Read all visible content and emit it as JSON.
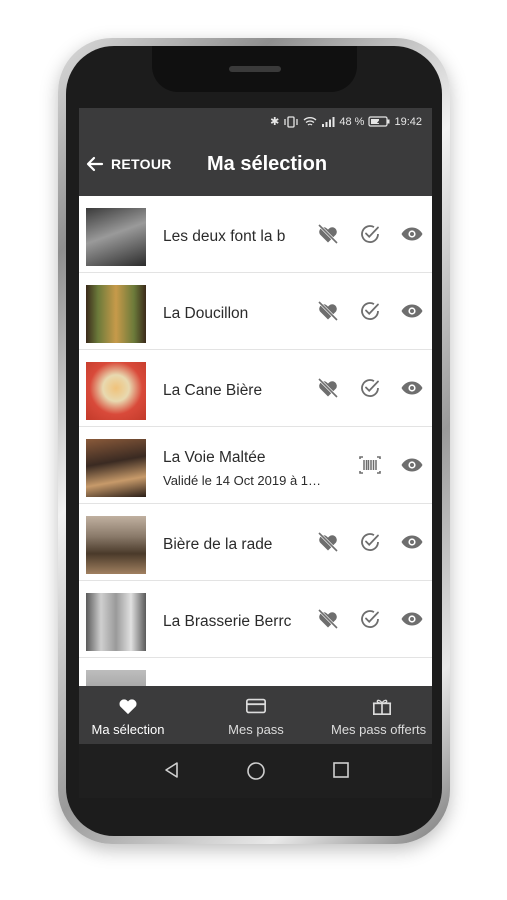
{
  "status": {
    "bluetooth": "✱",
    "signal": "48 %",
    "time": "19:42"
  },
  "appbar": {
    "back_label": "RETOUR",
    "title": "Ma sélection"
  },
  "places": [
    {
      "name": "Les deux font la b",
      "subtitle": "",
      "validated": false,
      "thumb_colors": [
        "#4a4a4a",
        "#8a8a8a",
        "#2c2c2c"
      ]
    },
    {
      "name": "La Doucillon",
      "subtitle": "",
      "validated": false,
      "thumb_colors": [
        "#6b7a3a",
        "#c79a4a",
        "#3b2a1a"
      ]
    },
    {
      "name": "La Cane Bière",
      "subtitle": "",
      "validated": false,
      "thumb_colors": [
        "#d94a3a",
        "#f0c27a",
        "#e8d9b0"
      ]
    },
    {
      "name": "La Voie Maltée",
      "subtitle": "Validé le 14 Oct 2019 à 1…",
      "validated": true,
      "thumb_colors": [
        "#3a2a22",
        "#8a5a3a",
        "#c79a6a"
      ]
    },
    {
      "name": "Bière de la rade",
      "subtitle": "",
      "validated": false,
      "thumb_colors": [
        "#8a7a6a",
        "#4a3a2a",
        "#c0b0a0"
      ]
    },
    {
      "name": "La Brasserie Berrc",
      "subtitle": "",
      "validated": false,
      "thumb_colors": [
        "#9a9a9a",
        "#5a5a5a",
        "#cfcfcf"
      ]
    }
  ],
  "icons": {
    "unfavorite": "heart-broken-icon",
    "validate": "check-circle-icon",
    "view": "eye-icon",
    "barcode": "barcode-icon"
  },
  "bottom_nav": [
    {
      "label": "Ma sélection",
      "icon": "heart-icon",
      "active": true
    },
    {
      "label": "Mes pass",
      "icon": "card-icon",
      "active": false
    },
    {
      "label": "Mes pass offerts",
      "icon": "gift-icon",
      "active": false
    }
  ],
  "colors": {
    "bar": "#3b3b3c",
    "icon": "#6e6e6e",
    "text": "#2b2b2b"
  }
}
